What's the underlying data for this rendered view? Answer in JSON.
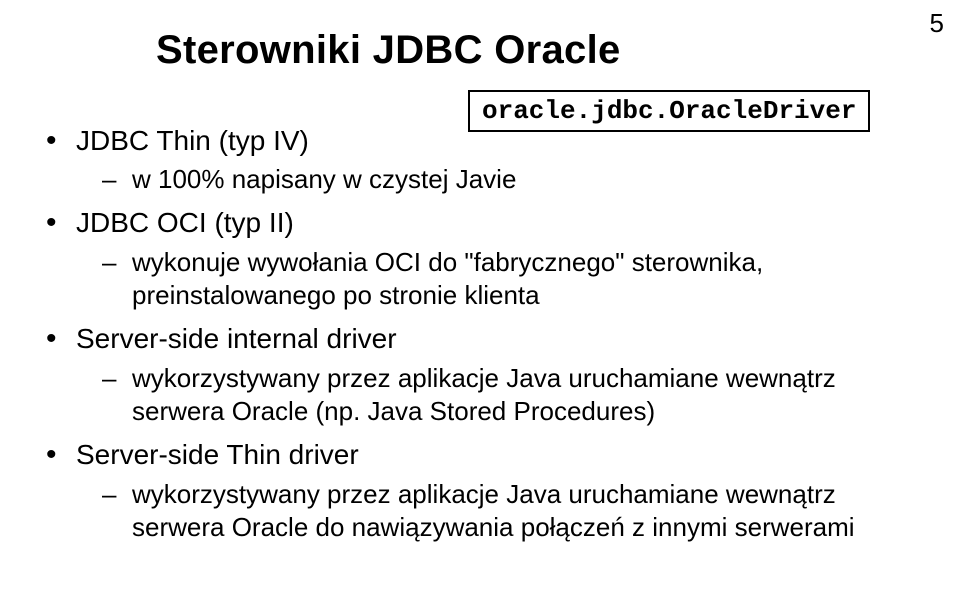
{
  "page_number": "5",
  "title": "Sterowniki JDBC Oracle",
  "driver_class": "oracle.jdbc.OracleDriver",
  "bullets": [
    {
      "heading": "JDBC Thin (typ IV)",
      "sub": [
        "w 100% napisany w czystej Javie"
      ]
    },
    {
      "heading": "JDBC OCI (typ II)",
      "sub": [
        "wykonuje wywołania OCI do \"fabrycznego\" sterownika, preinstalowanego po stronie klienta"
      ]
    },
    {
      "heading": "Server-side internal driver",
      "sub": [
        "wykorzystywany przez aplikacje Java uruchamiane wewnątrz serwera Oracle (np. Java Stored Procedures)"
      ]
    },
    {
      "heading": "Server-side Thin driver",
      "sub": [
        "wykorzystywany przez aplikacje Java uruchamiane wewnątrz serwera Oracle do nawiązywania połączeń z innymi serwerami"
      ]
    }
  ]
}
